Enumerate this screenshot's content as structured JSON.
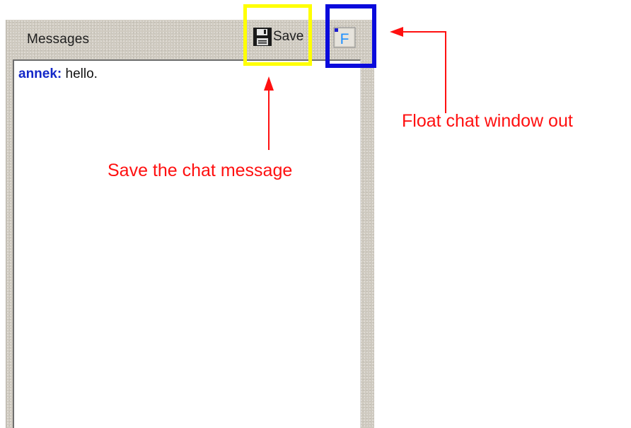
{
  "panel": {
    "title": "Messages",
    "save_label": "Save",
    "float_button_letter": "F"
  },
  "messages": [
    {
      "sender": "annek:",
      "text": "hello."
    }
  ],
  "annotations": {
    "save": "Save the chat message",
    "float": "Float chat window out"
  },
  "colors": {
    "annotation_red": "#ff1010",
    "highlight_yellow": "#ffff00",
    "highlight_blue": "#0a0adc",
    "sender_blue": "#1428c8"
  },
  "icons": {
    "save": "floppy-disk-icon",
    "float": "float-window-icon"
  }
}
